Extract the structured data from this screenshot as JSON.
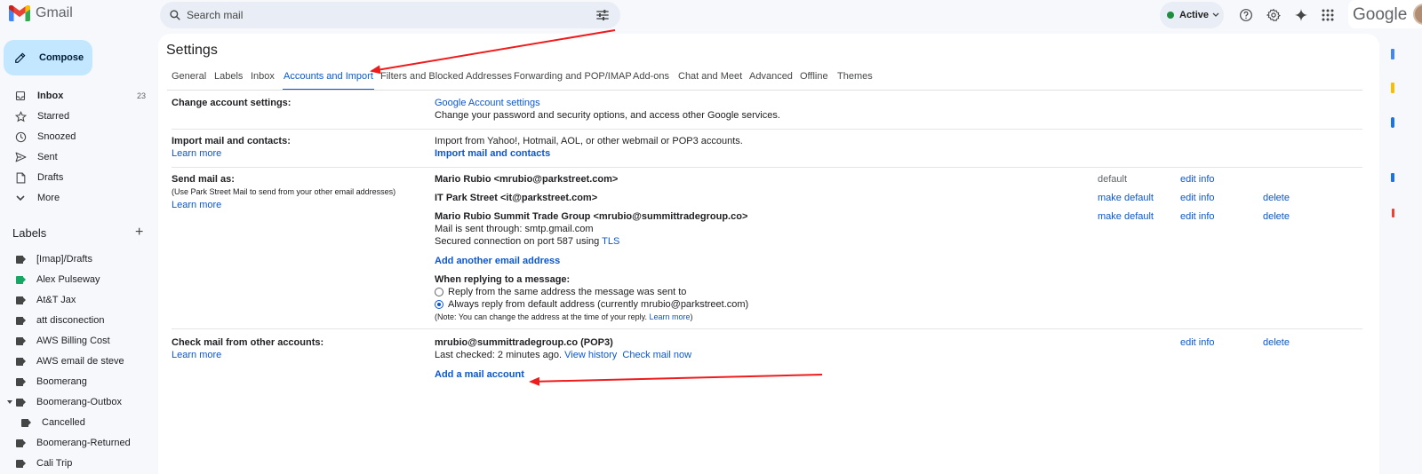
{
  "app": {
    "name": "Gmail"
  },
  "search": {
    "placeholder": "Search mail"
  },
  "status": {
    "label": "Active"
  },
  "google_label": "Google",
  "sidebar": {
    "compose": "Compose",
    "items": [
      {
        "label": "Inbox",
        "count": "23"
      },
      {
        "label": "Starred"
      },
      {
        "label": "Snoozed"
      },
      {
        "label": "Sent"
      },
      {
        "label": "Drafts"
      },
      {
        "label": "More"
      }
    ],
    "labels_title": "Labels",
    "labels": [
      {
        "label": "[Imap]/Drafts",
        "color": "#444746"
      },
      {
        "label": "Alex Pulseway",
        "color": "#16a765"
      },
      {
        "label": "At&T Jax",
        "color": "#444746"
      },
      {
        "label": "att disconection",
        "color": "#444746"
      },
      {
        "label": "AWS Billing Cost",
        "color": "#444746"
      },
      {
        "label": "AWS email de steve",
        "color": "#444746"
      },
      {
        "label": "Boomerang",
        "color": "#444746"
      },
      {
        "label": "Boomerang-Outbox",
        "color": "#444746"
      },
      {
        "label": "Cancelled",
        "color": "#444746"
      },
      {
        "label": "Boomerang-Returned",
        "color": "#444746"
      },
      {
        "label": "Cali Trip",
        "color": "#444746"
      }
    ]
  },
  "settings": {
    "title": "Settings",
    "tabs": [
      "General",
      "Labels",
      "Inbox",
      "Accounts and Import",
      "Filters and Blocked Addresses",
      "Forwarding and POP/IMAP",
      "Add-ons",
      "Chat and Meet",
      "Advanced",
      "Offline",
      "Themes"
    ],
    "active_tab": "Accounts and Import",
    "change_account": {
      "label": "Change account settings:",
      "link": "Google Account settings",
      "desc": "Change your password and security options, and access other Google services."
    },
    "import": {
      "label": "Import mail and contacts:",
      "learn_more": "Learn more",
      "desc": "Import from Yahoo!, Hotmail, AOL, or other webmail or POP3 accounts.",
      "link": "Import mail and contacts"
    },
    "send_as": {
      "label": "Send mail as:",
      "note": "(Use Park Street Mail to send from your other email addresses)",
      "learn_more": "Learn more",
      "addresses": [
        {
          "name": "Mario Rubio <mrubio@parkstreet.com>",
          "status": "default",
          "edit": "edit info"
        },
        {
          "name": "IT Park Street <it@parkstreet.com>",
          "status": "make default",
          "edit": "edit info",
          "delete": "delete"
        },
        {
          "name": "Mario Rubio Summit Trade Group <mrubio@summittradegroup.co>",
          "status": "make default",
          "edit": "edit info",
          "delete": "delete"
        }
      ],
      "sent_through": "Mail is sent through: smtp.gmail.com",
      "secured": "Secured connection on port 587 using",
      "tls": "TLS",
      "add_another": "Add another email address",
      "reply_title": "When replying to a message:",
      "reply_opt1": "Reply from the same address the message was sent to",
      "reply_opt2": "Always reply from default address (currently mrubio@parkstreet.com)",
      "reply_note": "(Note: You can change the address at the time of your reply.",
      "reply_note_link": "Learn more",
      "reply_note_end": ")"
    },
    "check_mail": {
      "label": "Check mail from other accounts:",
      "learn_more": "Learn more",
      "account": "mrubio@summittradegroup.co (POP3)",
      "last_checked": "Last checked: 2 minutes ago.",
      "view_history": "View history",
      "check_now": "Check mail now",
      "edit": "edit info",
      "delete": "delete",
      "add_account": "Add a mail account"
    }
  },
  "colors": {
    "accent": "#0b57d0",
    "compose_bg": "#c2e7ff",
    "arrow": "#ee1c1c"
  }
}
